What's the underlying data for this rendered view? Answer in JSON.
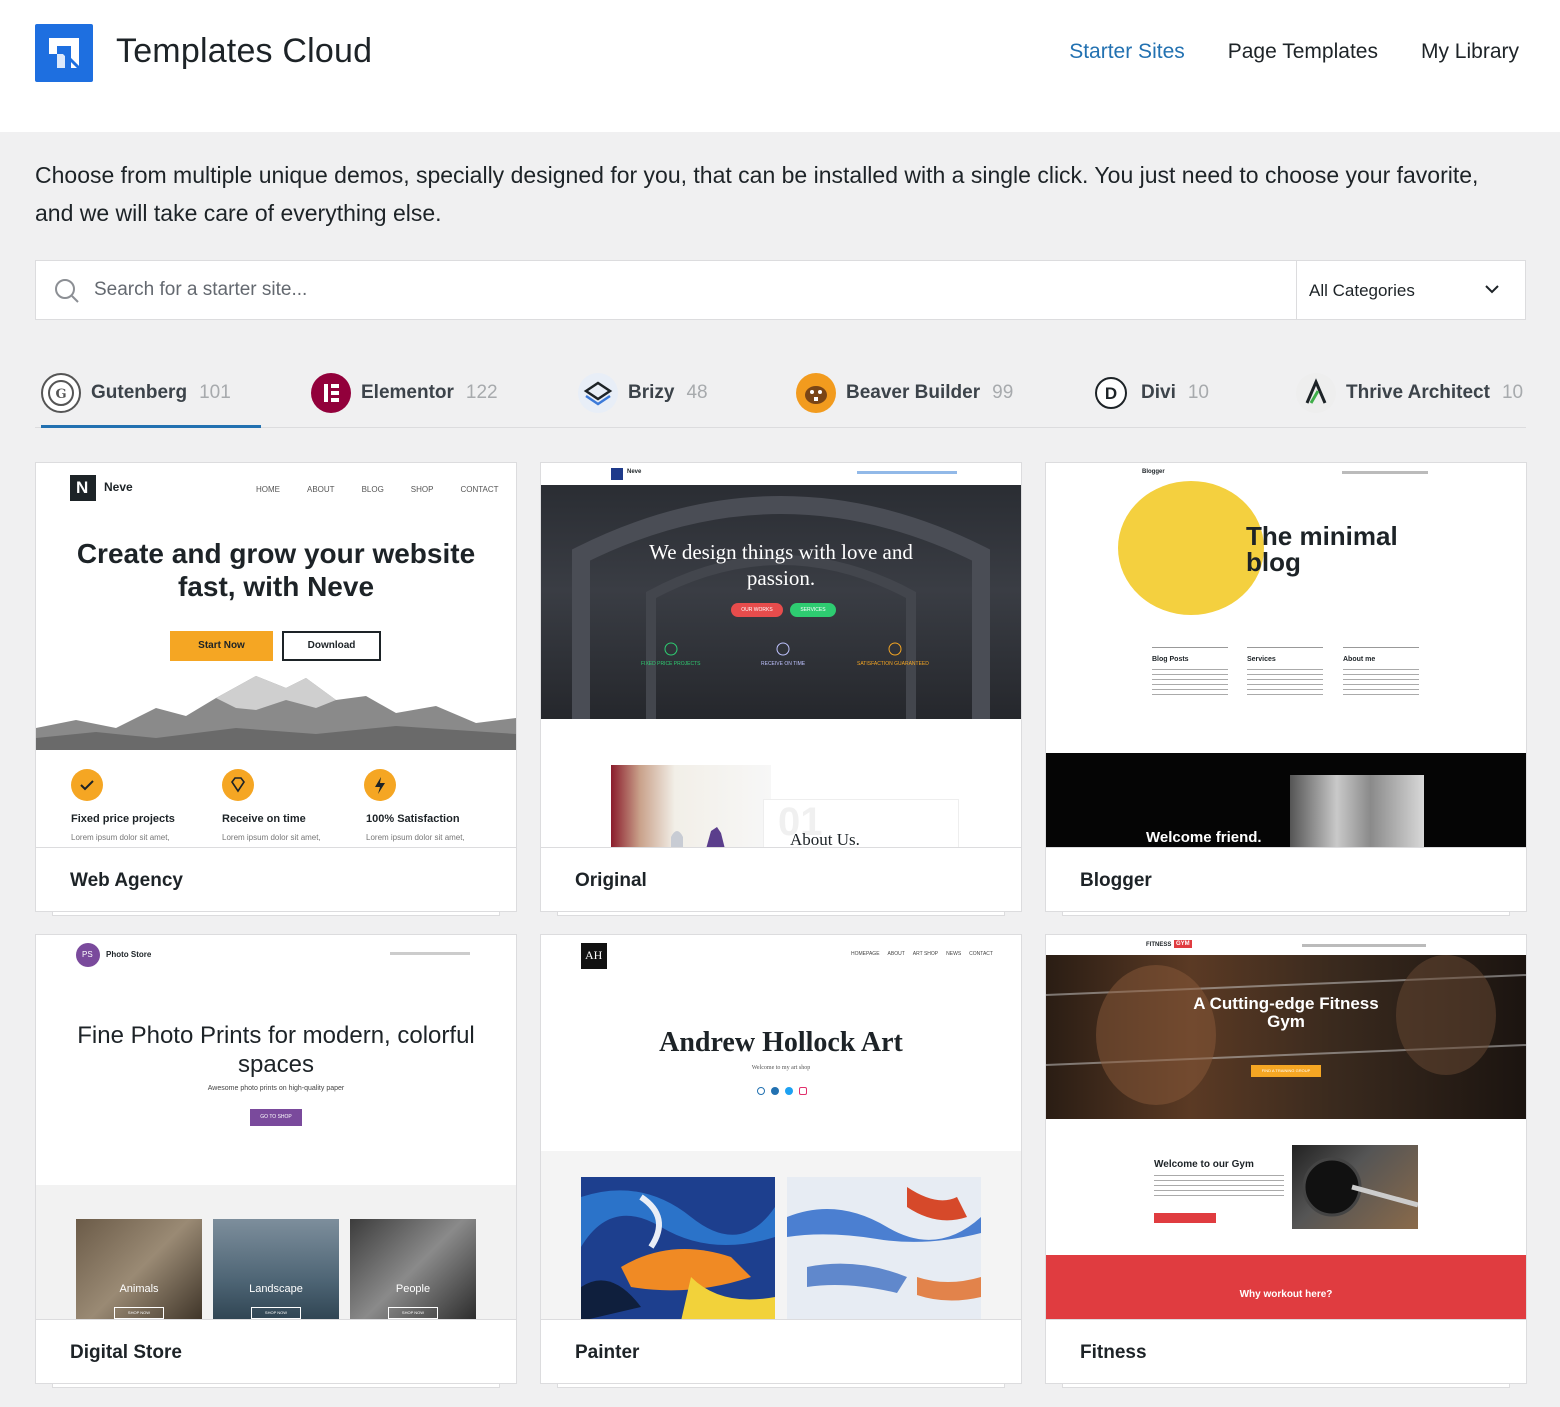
{
  "app": {
    "title": "Templates Cloud"
  },
  "nav": {
    "starter_sites": "Starter Sites",
    "page_templates": "Page Templates",
    "my_library": "My Library"
  },
  "intro": "Choose from multiple unique demos, specially designed for you, that can be installed with a single click. You just need to choose your favorite, and we will take care of everything else.",
  "search": {
    "placeholder": "Search for a starter site...",
    "category_selected": "All Categories"
  },
  "tabs": [
    {
      "label": "Gutenberg",
      "count": "101"
    },
    {
      "label": "Elementor",
      "count": "122"
    },
    {
      "label": "Brizy",
      "count": "48"
    },
    {
      "label": "Beaver Builder",
      "count": "99"
    },
    {
      "label": "Divi",
      "count": "10"
    },
    {
      "label": "Thrive Architect",
      "count": "10"
    }
  ],
  "cards": [
    {
      "name": "Web Agency",
      "preview": {
        "brand": "Neve",
        "menu": [
          "HOME",
          "ABOUT",
          "BLOG",
          "SHOP",
          "CONTACT"
        ],
        "headline": "Create and grow your website fast, with Neve",
        "btn_primary": "Start Now",
        "btn_secondary": "Download",
        "features": [
          "Fixed price projects",
          "Receive on time",
          "100% Satisfaction"
        ],
        "feature_text": "Lorem ipsum dolor sit amet,"
      }
    },
    {
      "name": "Original",
      "preview": {
        "brand": "Neve",
        "headline": "We design things with love and passion.",
        "btn_a": "OUR WORKS",
        "btn_b": "SERVICES",
        "features": [
          "FIXED PRICE PROJECTS",
          "RECEIVE ON TIME",
          "SATISFACTION GUARANTEED"
        ],
        "about": "About Us."
      }
    },
    {
      "name": "Blogger",
      "preview": {
        "brand": "Blogger",
        "headline": "The minimal blog",
        "columns": [
          "Blog Posts",
          "Services",
          "About me"
        ],
        "welcome": "Welcome friend."
      }
    },
    {
      "name": "Digital Store",
      "preview": {
        "brand": "Photo Store",
        "headline": "Fine Photo Prints for modern, colorful spaces",
        "sub": "Awesome photo prints on high-quality paper",
        "btn": "GO TO SHOP",
        "tiles": [
          "Animals",
          "Landscape",
          "People"
        ],
        "tile_btn": "SHOP NOW"
      }
    },
    {
      "name": "Painter",
      "preview": {
        "menu": [
          "HOMEPAGE",
          "ABOUT",
          "ART SHOP",
          "NEWS",
          "CONTACT"
        ],
        "headline": "Andrew Hollock Art",
        "sub": "Welcome to my art shop"
      }
    },
    {
      "name": "Fitness",
      "preview": {
        "brand": "FITNESS",
        "brand_badge": "GYM",
        "headline": "A Cutting-edge Fitness Gym",
        "btn": "FIND A TRAINING GROUP",
        "welcome": "Welcome to our Gym",
        "why": "Why workout here?"
      }
    }
  ],
  "colors": {
    "accent": "#2271b1",
    "logo": "#1e6fe0",
    "neve_orange": "#f5a623",
    "fitness_red": "#e03c40",
    "store_purple": "#7a4a9c",
    "blog_yellow": "#f4d03f"
  }
}
